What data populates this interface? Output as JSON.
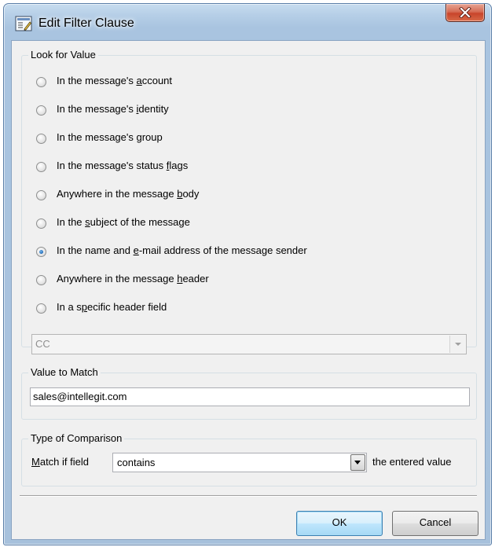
{
  "window": {
    "title": "Edit Filter Clause",
    "icon": "filter-edit-icon",
    "close_icon": "close-icon"
  },
  "look_for_value": {
    "label": "Look for Value",
    "options": [
      {
        "pre": "In the message's ",
        "key": "a",
        "post": "ccount",
        "checked": false
      },
      {
        "pre": "In the message's ",
        "key": "i",
        "post": "dentity",
        "checked": false
      },
      {
        "pre": "In the message's ",
        "key": "g",
        "post": "roup",
        "checked": false
      },
      {
        "pre": "In the message's status ",
        "key": "f",
        "post": "lags",
        "checked": false
      },
      {
        "pre": "Anywhere in the message ",
        "key": "b",
        "post": "ody",
        "checked": false
      },
      {
        "pre": "In the ",
        "key": "s",
        "post": "ubject of the message",
        "checked": false
      },
      {
        "pre": "In the name and ",
        "key": "e",
        "post": "-mail address of the message sender",
        "checked": true
      },
      {
        "pre": "Anywhere in the message ",
        "key": "h",
        "post": "eader",
        "checked": false
      },
      {
        "pre": "In a s",
        "key": "p",
        "post": "ecific header field",
        "checked": false
      }
    ],
    "header_field_value": "CC"
  },
  "value_to_match": {
    "label": "Value to Match",
    "value": "sales@intellegit.com"
  },
  "type_of_comparison": {
    "label": "Type of Comparison",
    "match_key": "M",
    "match_rest": "atch if field",
    "selected": "contains",
    "suffix": "the entered value"
  },
  "buttons": {
    "ok": "OK",
    "cancel": "Cancel"
  },
  "colors": {
    "title_bar": "#b6cfe7",
    "close_button": "#c8452b",
    "dialog_bg": "#f0f0f0",
    "default_button": "#bee6fd"
  }
}
